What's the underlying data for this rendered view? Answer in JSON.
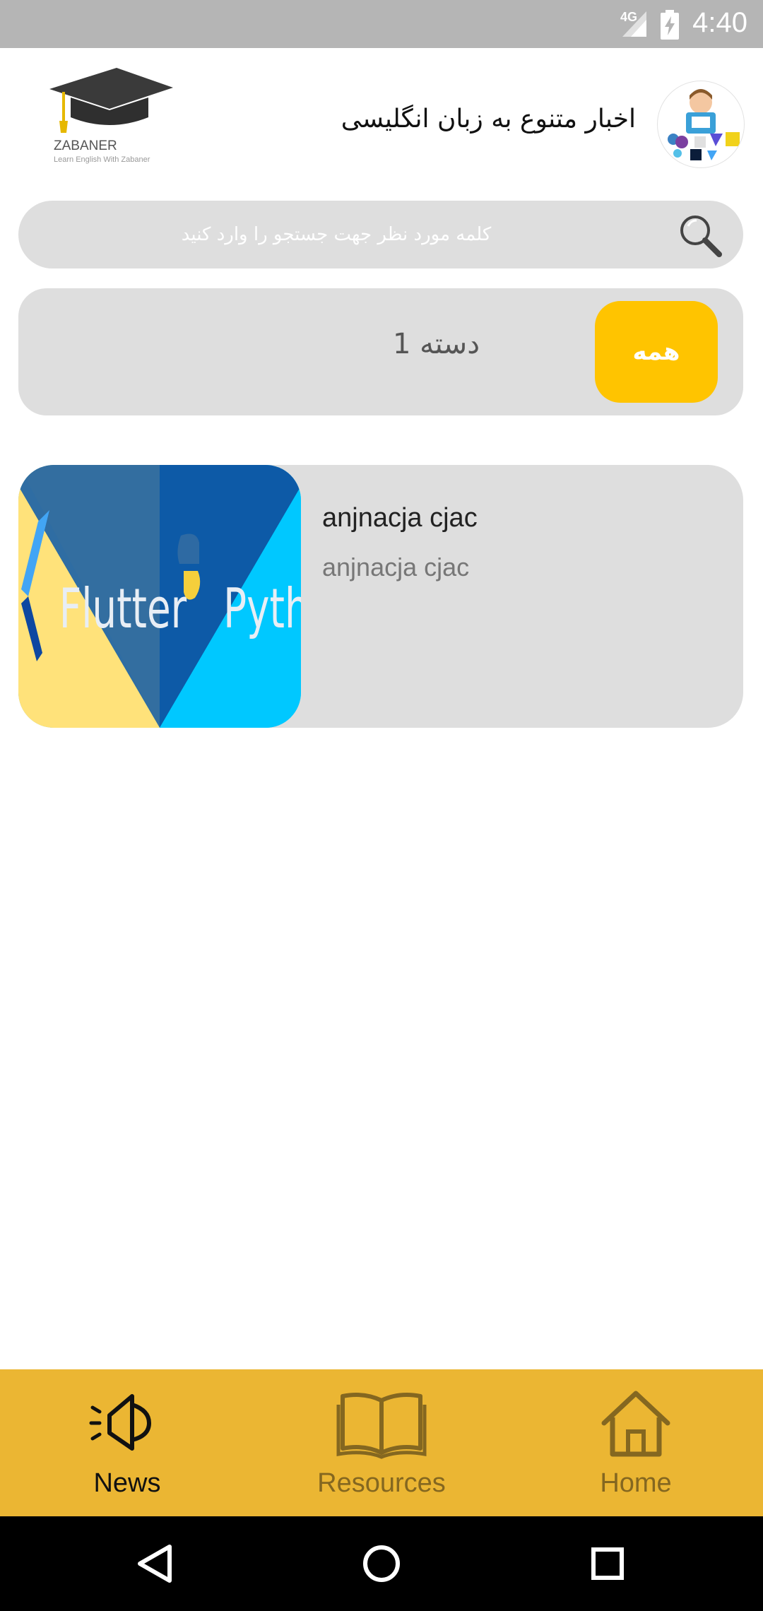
{
  "status_bar": {
    "time": "4:40",
    "network": "4G"
  },
  "header": {
    "logo_brand": "ZABANER",
    "logo_tagline": "Learn English With Zabaner",
    "title": "اخبار متنوع به زبان انگلیسی"
  },
  "search": {
    "placeholder": "کلمه مورد نظر جهت جستجو را وارد کنید"
  },
  "categories": [
    {
      "label": "همه",
      "active": true
    },
    {
      "label": "دسته 1",
      "active": false
    }
  ],
  "news_items": [
    {
      "title": "anjnacja cjac",
      "subtitle": "anjnacja cjac",
      "image_text": [
        "Flutter",
        "Python"
      ]
    }
  ],
  "bottom_nav": [
    {
      "label": "News",
      "icon": "megaphone-icon",
      "active": true
    },
    {
      "label": "Resources",
      "icon": "book-icon",
      "active": false
    },
    {
      "label": "Home",
      "icon": "home-icon",
      "active": false
    }
  ],
  "colors": {
    "accent": "#ffc400",
    "nav_bg": "#ebb633",
    "card_bg": "#dedede",
    "status_bg": "#b5b5b5"
  }
}
